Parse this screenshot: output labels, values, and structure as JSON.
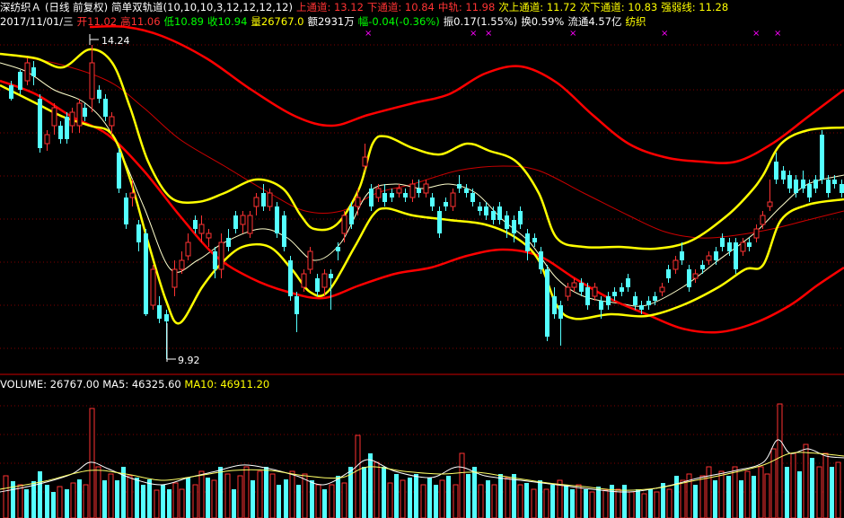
{
  "header1": {
    "stock_name": "深纺织Ａ",
    "period_adj": "(日线 前复权)",
    "indicator_name": "简单双轨道",
    "indicator_params": "(10,10,10,3,12,12,12,12)",
    "items": [
      {
        "label": "上通道: ",
        "value": "13.12",
        "color": "#ff3333"
      },
      {
        "label": "下通道: ",
        "value": "10.84",
        "color": "#ff3333"
      },
      {
        "label": "中轨: ",
        "value": "11.98",
        "color": "#ff3333"
      },
      {
        "label": "次上通道: ",
        "value": "11.72",
        "color": "#ffff00"
      },
      {
        "label": "次下通道: ",
        "value": "10.83",
        "color": "#ffff00"
      },
      {
        "label": "强弱线: ",
        "value": "11.28",
        "color": "#ffff00"
      }
    ]
  },
  "header2": {
    "date": "2017/11/01/三",
    "items": [
      {
        "label": "开",
        "value": "11.02",
        "color": "#ff3333"
      },
      {
        "label": "高",
        "value": "11.06",
        "color": "#ff3333"
      },
      {
        "label": "低",
        "value": "10.89",
        "color": "#00ff00"
      },
      {
        "label": "收",
        "value": "10.94",
        "color": "#00ff00"
      },
      {
        "label": "量",
        "value": "26767.0",
        "color": "#ffff00"
      },
      {
        "label": "额",
        "value": "2931万",
        "color": "#ffffff"
      },
      {
        "label": "幅",
        "value": "-0.04(-0.36%)",
        "color": "#00ff00"
      },
      {
        "label": "振",
        "value": "0.17(1.55%)",
        "color": "#ffffff"
      },
      {
        "label": "换",
        "value": "0.59%",
        "color": "#ffffff"
      },
      {
        "label": "流通",
        "value": "4.57亿",
        "color": "#ffffff"
      },
      {
        "label": "",
        "value": "纺织",
        "color": "#ffff00"
      }
    ]
  },
  "volume_header": {
    "volume_label": "VOLUME: ",
    "volume_value": "26767.00",
    "ma5_label": "MA5: ",
    "ma5_value": "46325.60",
    "ma10_label": "MA10: ",
    "ma10_value": "46911.20"
  },
  "price_labels": {
    "high": "14.24",
    "low": "9.92"
  },
  "colors": {
    "background": "#000000",
    "up": "#ff3232",
    "down": "#54ffff",
    "outer_channel": "#ff0000",
    "inner_channel": "#ffff00",
    "mid_line": "#cc0000",
    "strength_line": "#ffffcc",
    "grid": "#800000",
    "marker": "#ff00ff",
    "text_white": "#ffffff",
    "text_yellow": "#ffff00",
    "text_red": "#ff3333"
  }
}
